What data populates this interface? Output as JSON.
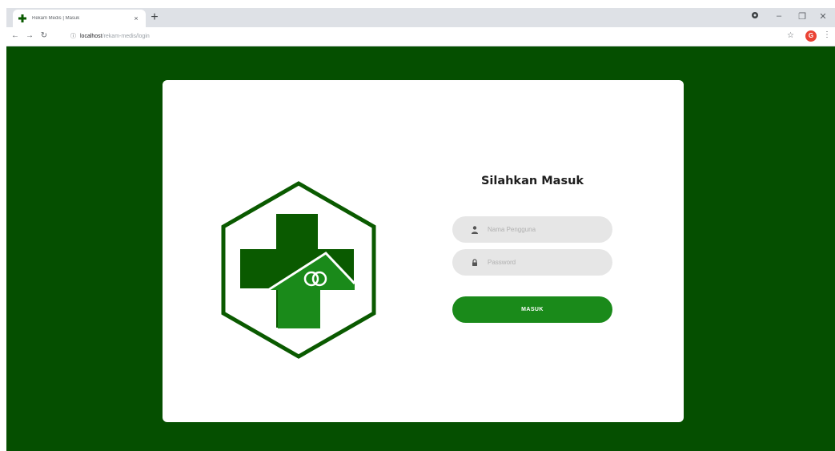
{
  "browser": {
    "tab_title": "Rekam Medis | Masuk",
    "tab_close": "×",
    "new_tab": "+",
    "url_host": "localhost",
    "url_path": "/rekam-medis/login",
    "window_minimize": "–",
    "window_restore": "❐",
    "window_close": "✕",
    "avatar_initial": "G",
    "icons": [
      "info-icon",
      "back-arrow-icon",
      "forward-arrow-icon",
      "reload-icon",
      "star-icon",
      "menu-dots-icon",
      "extension-icon"
    ]
  },
  "login": {
    "title": "Silahkan Masuk",
    "username_placeholder": "Nama Pengguna",
    "password_placeholder": "Password",
    "submit_label": "MASUK",
    "icons": [
      "user-icon",
      "lock-icon"
    ]
  },
  "colors": {
    "page_bg": "#054f00",
    "logo_dark": "#0a5a00",
    "logo_light": "#1a8a1a",
    "button": "#1a8a1a",
    "field_bg": "#e6e6e6"
  }
}
